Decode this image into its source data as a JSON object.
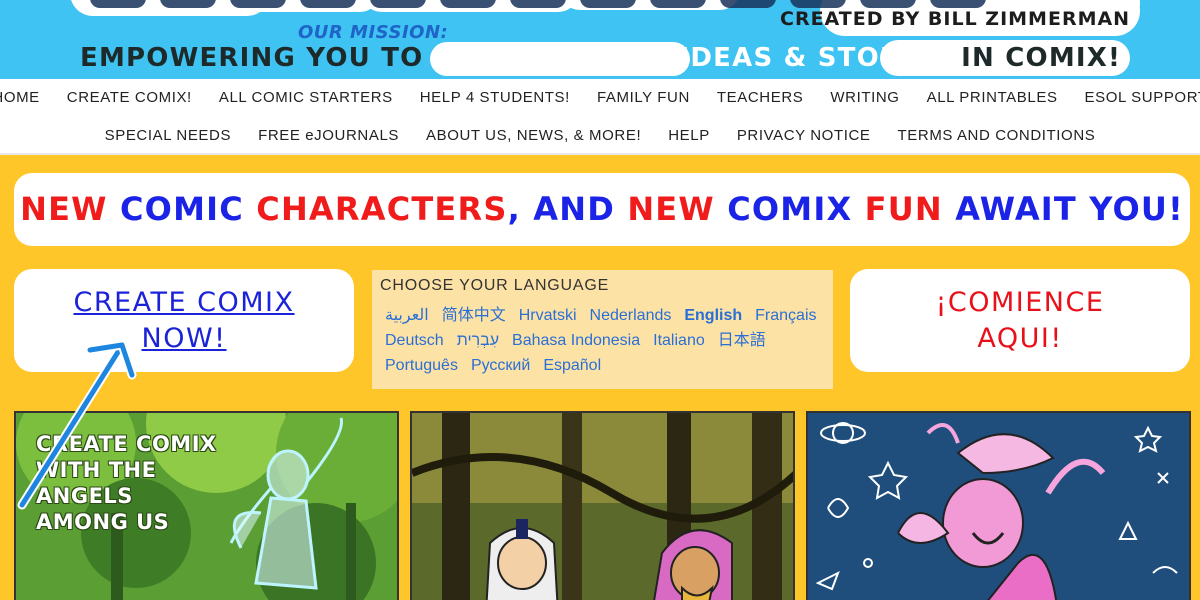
{
  "header": {
    "created_by": "CREATED BY BILL ZIMMERMAN",
    "mission_label": "OUR MISSION:",
    "mission_dark_1": "EMPOWERING YOU TO",
    "mission_light": "EXPRESS YOUR IDEAS & STORIES",
    "mission_dark_2": "IN COMIX!"
  },
  "nav": {
    "row1": [
      "HOME",
      "CREATE COMIX!",
      "ALL COMIC STARTERS",
      "HELP 4 STUDENTS!",
      "FAMILY FUN",
      "TEACHERS",
      "WRITING",
      "ALL PRINTABLES",
      "ESOL SUPPORT"
    ],
    "row2": [
      "SPECIAL NEEDS",
      "FREE eJOURNALS",
      "ABOUT US, NEWS, & MORE!",
      "HELP",
      "PRIVACY NOTICE",
      "TERMS AND CONDITIONS"
    ]
  },
  "banner": {
    "parts": [
      {
        "text": "NEW ",
        "color": "#f01b1b"
      },
      {
        "text": "COMIC ",
        "color": "#1a23e6"
      },
      {
        "text": "CHARACTERS",
        "color": "#f01b1b"
      },
      {
        "text": ", AND ",
        "color": "#1a23e6"
      },
      {
        "text": "NEW ",
        "color": "#f01b1b"
      },
      {
        "text": "COMIX ",
        "color": "#1a23e6"
      },
      {
        "text": "FUN ",
        "color": "#f01b1b"
      },
      {
        "text": "AWAIT YOU!",
        "color": "#1a23e6"
      }
    ]
  },
  "create_box": {
    "line1": "CREATE COMIX",
    "line2": "NOW!"
  },
  "language": {
    "heading": "CHOOSE YOUR LANGUAGE",
    "options": [
      "العربية",
      "简体中文",
      "Hrvatski",
      "Nederlands",
      "English",
      "Français",
      "Deutsch",
      "עִבְרִית",
      "Bahasa Indonesia",
      "Italiano",
      "日本語",
      "Português",
      "Русский",
      "Español"
    ],
    "current": "English"
  },
  "comience_box": {
    "line1": "¡COMIENCE",
    "line2": "AQUI!"
  },
  "panels": {
    "angels_caption": [
      "CREATE COMIX",
      "WITH THE",
      "ANGELS",
      "AMONG US"
    ]
  },
  "colors": {
    "page_background": "#ffc629",
    "header_background": "#3ec3f2",
    "link_blue": "#1a23d8",
    "accent_red": "#e8111a"
  }
}
